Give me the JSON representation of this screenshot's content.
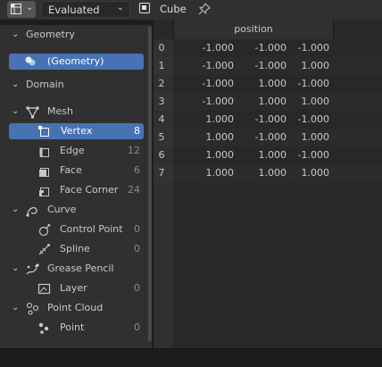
{
  "header": {
    "editor_type_icon": "spreadsheet-icon",
    "evaluation_mode": "Evaluated",
    "object_name": "Cube",
    "pin_icon": "pin-icon"
  },
  "sidebar": {
    "geometry_section": "Geometry",
    "geometry_item": "(Geometry)",
    "domain_section": "Domain",
    "mesh": {
      "label": "Mesh"
    },
    "vertex": {
      "label": "Vertex",
      "count": "8"
    },
    "edge": {
      "label": "Edge",
      "count": "12"
    },
    "face": {
      "label": "Face",
      "count": "6"
    },
    "face_corner": {
      "label": "Face Corner",
      "count": "24"
    },
    "curve": {
      "label": "Curve"
    },
    "control_point": {
      "label": "Control Point",
      "count": "0"
    },
    "spline": {
      "label": "Spline",
      "count": "0"
    },
    "grease_pencil": {
      "label": "Grease Pencil"
    },
    "layer": {
      "label": "Layer",
      "count": "0"
    },
    "point_cloud": {
      "label": "Point Cloud"
    },
    "point": {
      "label": "Point",
      "count": "0"
    }
  },
  "table": {
    "column": "position",
    "rows": [
      {
        "index": "0",
        "x": "-1.000",
        "y": "-1.000",
        "z": "-1.000"
      },
      {
        "index": "1",
        "x": "-1.000",
        "y": "-1.000",
        "z": "1.000"
      },
      {
        "index": "2",
        "x": "-1.000",
        "y": "1.000",
        "z": "-1.000"
      },
      {
        "index": "3",
        "x": "-1.000",
        "y": "1.000",
        "z": "1.000"
      },
      {
        "index": "4",
        "x": "1.000",
        "y": "-1.000",
        "z": "-1.000"
      },
      {
        "index": "5",
        "x": "1.000",
        "y": "-1.000",
        "z": "1.000"
      },
      {
        "index": "6",
        "x": "1.000",
        "y": "1.000",
        "z": "-1.000"
      },
      {
        "index": "7",
        "x": "1.000",
        "y": "1.000",
        "z": "1.000"
      }
    ]
  },
  "colors": {
    "selected": "#4772b3",
    "panel": "#303030",
    "background": "#1d1d1d"
  }
}
